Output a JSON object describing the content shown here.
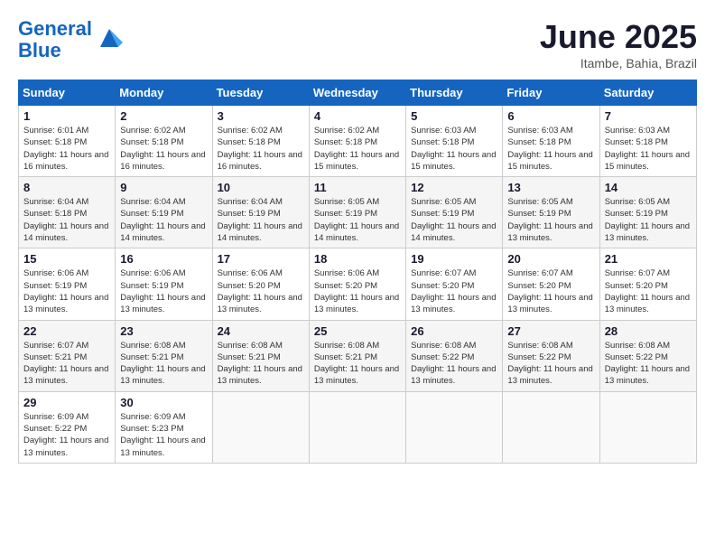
{
  "header": {
    "logo_line1": "General",
    "logo_line2": "Blue",
    "month": "June 2025",
    "location": "Itambe, Bahia, Brazil"
  },
  "days_of_week": [
    "Sunday",
    "Monday",
    "Tuesday",
    "Wednesday",
    "Thursday",
    "Friday",
    "Saturday"
  ],
  "weeks": [
    [
      {
        "day": 1,
        "info": "Sunrise: 6:01 AM\nSunset: 5:18 PM\nDaylight: 11 hours and 16 minutes."
      },
      {
        "day": 2,
        "info": "Sunrise: 6:02 AM\nSunset: 5:18 PM\nDaylight: 11 hours and 16 minutes."
      },
      {
        "day": 3,
        "info": "Sunrise: 6:02 AM\nSunset: 5:18 PM\nDaylight: 11 hours and 16 minutes."
      },
      {
        "day": 4,
        "info": "Sunrise: 6:02 AM\nSunset: 5:18 PM\nDaylight: 11 hours and 15 minutes."
      },
      {
        "day": 5,
        "info": "Sunrise: 6:03 AM\nSunset: 5:18 PM\nDaylight: 11 hours and 15 minutes."
      },
      {
        "day": 6,
        "info": "Sunrise: 6:03 AM\nSunset: 5:18 PM\nDaylight: 11 hours and 15 minutes."
      },
      {
        "day": 7,
        "info": "Sunrise: 6:03 AM\nSunset: 5:18 PM\nDaylight: 11 hours and 15 minutes."
      }
    ],
    [
      {
        "day": 8,
        "info": "Sunrise: 6:04 AM\nSunset: 5:18 PM\nDaylight: 11 hours and 14 minutes."
      },
      {
        "day": 9,
        "info": "Sunrise: 6:04 AM\nSunset: 5:19 PM\nDaylight: 11 hours and 14 minutes."
      },
      {
        "day": 10,
        "info": "Sunrise: 6:04 AM\nSunset: 5:19 PM\nDaylight: 11 hours and 14 minutes."
      },
      {
        "day": 11,
        "info": "Sunrise: 6:05 AM\nSunset: 5:19 PM\nDaylight: 11 hours and 14 minutes."
      },
      {
        "day": 12,
        "info": "Sunrise: 6:05 AM\nSunset: 5:19 PM\nDaylight: 11 hours and 14 minutes."
      },
      {
        "day": 13,
        "info": "Sunrise: 6:05 AM\nSunset: 5:19 PM\nDaylight: 11 hours and 13 minutes."
      },
      {
        "day": 14,
        "info": "Sunrise: 6:05 AM\nSunset: 5:19 PM\nDaylight: 11 hours and 13 minutes."
      }
    ],
    [
      {
        "day": 15,
        "info": "Sunrise: 6:06 AM\nSunset: 5:19 PM\nDaylight: 11 hours and 13 minutes."
      },
      {
        "day": 16,
        "info": "Sunrise: 6:06 AM\nSunset: 5:19 PM\nDaylight: 11 hours and 13 minutes."
      },
      {
        "day": 17,
        "info": "Sunrise: 6:06 AM\nSunset: 5:20 PM\nDaylight: 11 hours and 13 minutes."
      },
      {
        "day": 18,
        "info": "Sunrise: 6:06 AM\nSunset: 5:20 PM\nDaylight: 11 hours and 13 minutes."
      },
      {
        "day": 19,
        "info": "Sunrise: 6:07 AM\nSunset: 5:20 PM\nDaylight: 11 hours and 13 minutes."
      },
      {
        "day": 20,
        "info": "Sunrise: 6:07 AM\nSunset: 5:20 PM\nDaylight: 11 hours and 13 minutes."
      },
      {
        "day": 21,
        "info": "Sunrise: 6:07 AM\nSunset: 5:20 PM\nDaylight: 11 hours and 13 minutes."
      }
    ],
    [
      {
        "day": 22,
        "info": "Sunrise: 6:07 AM\nSunset: 5:21 PM\nDaylight: 11 hours and 13 minutes."
      },
      {
        "day": 23,
        "info": "Sunrise: 6:08 AM\nSunset: 5:21 PM\nDaylight: 11 hours and 13 minutes."
      },
      {
        "day": 24,
        "info": "Sunrise: 6:08 AM\nSunset: 5:21 PM\nDaylight: 11 hours and 13 minutes."
      },
      {
        "day": 25,
        "info": "Sunrise: 6:08 AM\nSunset: 5:21 PM\nDaylight: 11 hours and 13 minutes."
      },
      {
        "day": 26,
        "info": "Sunrise: 6:08 AM\nSunset: 5:22 PM\nDaylight: 11 hours and 13 minutes."
      },
      {
        "day": 27,
        "info": "Sunrise: 6:08 AM\nSunset: 5:22 PM\nDaylight: 11 hours and 13 minutes."
      },
      {
        "day": 28,
        "info": "Sunrise: 6:08 AM\nSunset: 5:22 PM\nDaylight: 11 hours and 13 minutes."
      }
    ],
    [
      {
        "day": 29,
        "info": "Sunrise: 6:09 AM\nSunset: 5:22 PM\nDaylight: 11 hours and 13 minutes."
      },
      {
        "day": 30,
        "info": "Sunrise: 6:09 AM\nSunset: 5:23 PM\nDaylight: 11 hours and 13 minutes."
      },
      null,
      null,
      null,
      null,
      null
    ]
  ]
}
